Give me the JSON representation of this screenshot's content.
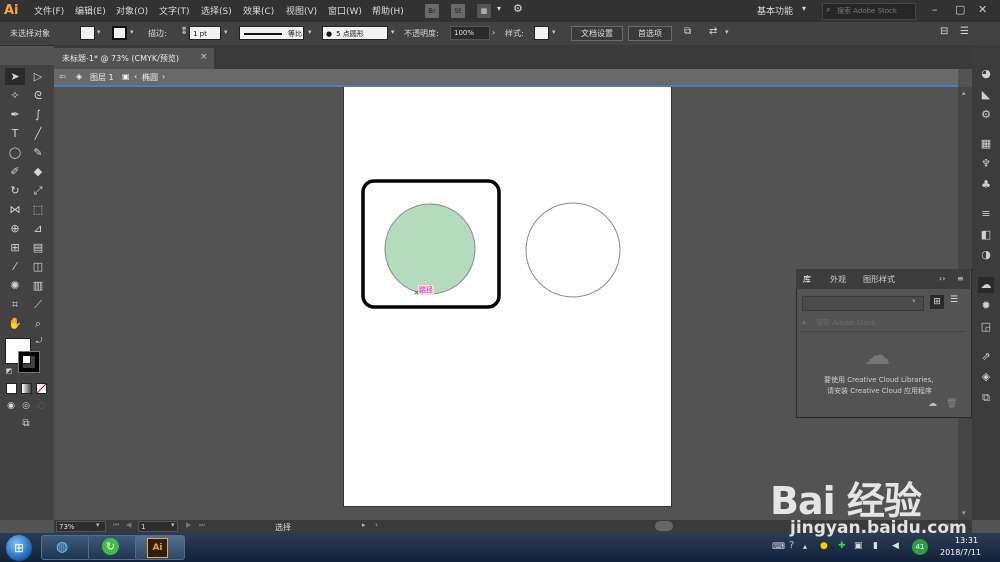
{
  "app": {
    "logo": "Ai"
  },
  "menu": [
    "文件(F)",
    "编辑(E)",
    "对象(O)",
    "文字(T)",
    "选择(S)",
    "效果(C)",
    "视图(V)",
    "窗口(W)",
    "帮助(H)"
  ],
  "menu_buttons": {
    "bridge": "Br",
    "stock": "St"
  },
  "workspace": {
    "label": "基本功能"
  },
  "search": {
    "placeholder": "搜索 Adobe Stock"
  },
  "control_bar": {
    "no_selection": "未选择对象",
    "stroke_label": "描边:",
    "stroke_value": "1 pt",
    "profile_label": "等比",
    "brush_label": "5 点圆形",
    "opacity_label": "不透明度:",
    "opacity_value": "100%",
    "style_label": "样式:",
    "doc_setup": "文档设置",
    "preferences": "首选项"
  },
  "document_tab": {
    "title": "未标题-1* @ 73% (CMYK/预览)",
    "close": "×"
  },
  "breadcrumb": {
    "layer": "图层 1",
    "object": "椭圆"
  },
  "canvas": {
    "anchor_label": "路径",
    "shapes": [
      {
        "name": "rounded-rect",
        "fill": "#ffffff",
        "stroke": "#000000"
      },
      {
        "name": "green-circle",
        "fill": "#b3dcbd",
        "stroke": "#8a8a8a"
      },
      {
        "name": "outline-circle",
        "fill": "#ffffff",
        "stroke": "#8a8a8a"
      }
    ]
  },
  "library_panel": {
    "tabs": [
      "库",
      "外观",
      "图形样式"
    ],
    "search_placeholder": "搜索 Adobe Stock",
    "message_line1": "要使用 Creative Cloud Libraries,",
    "message_line2": "请安装 Creative Cloud 应用程序"
  },
  "status_bar": {
    "zoom": "73%",
    "page": "1",
    "tool": "选择"
  },
  "taskbar": {
    "time": "13:31",
    "date": "2018/7/11",
    "tray_badge": "41"
  },
  "watermark": {
    "line1": "Bai 经验",
    "line2": "jingyan.baidu.com"
  },
  "colors": {
    "accent": "#4b7bc7",
    "ai_orange": "#f7a536",
    "circle_fill": "#b3dcbd"
  }
}
